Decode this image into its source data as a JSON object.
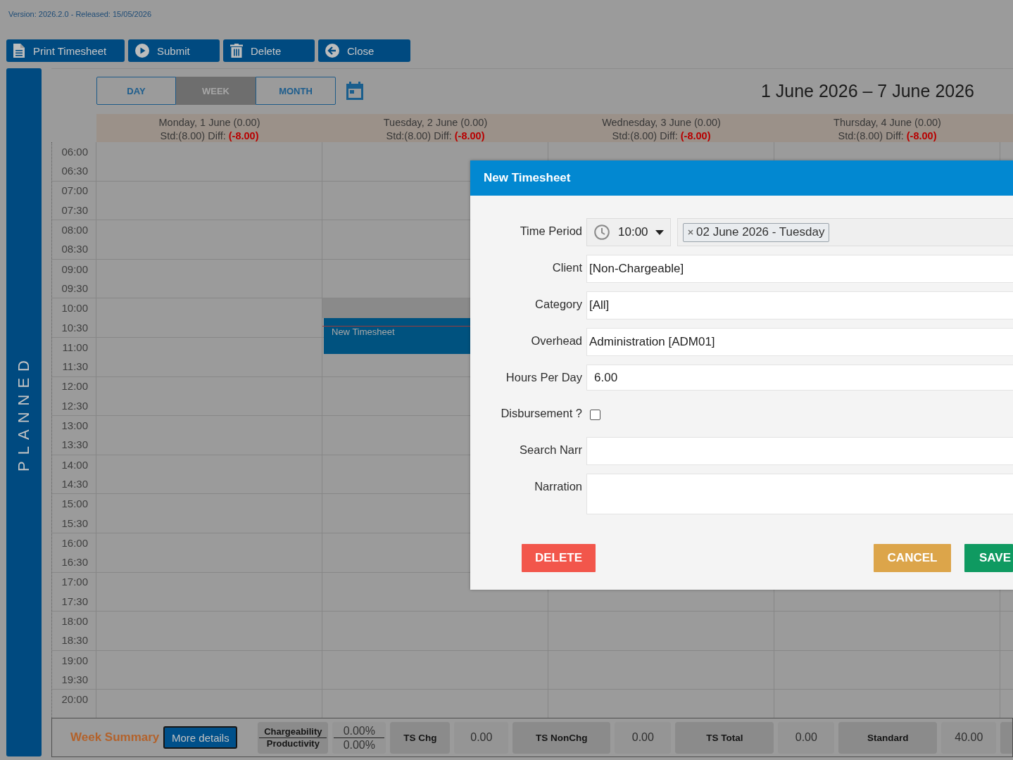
{
  "version_text": "Version: 2026.2.0 - Released: 15/05/2026",
  "toolbar": [
    {
      "label": "Print Timesheet",
      "kind": "print"
    },
    {
      "label": "Submit",
      "kind": "submit"
    },
    {
      "label": "Delete",
      "kind": "delete"
    },
    {
      "label": "Close",
      "kind": "close"
    }
  ],
  "sidebar": {
    "label": "PLANNED"
  },
  "view_tabs": [
    {
      "label": "DAY",
      "selected": false
    },
    {
      "label": "WEEK",
      "selected": true
    },
    {
      "label": "MONTH",
      "selected": false
    }
  ],
  "date_range": "1 June 2026 – 7 June 2026",
  "days": [
    {
      "title": "Monday, 1 June (0.00)",
      "std": "Std:(8.00) Diff:",
      "diff": "(-8.00)"
    },
    {
      "title": "Tuesday, 2 June (0.00)",
      "std": "Std:(8.00) Diff:",
      "diff": "(-8.00)",
      "events": [
        {
          "title": "New Timesheet"
        }
      ]
    },
    {
      "title": "Wednesday, 3 June (0.00)",
      "std": "Std:(8.00) Diff:",
      "diff": "(-8.00)"
    },
    {
      "title": "Thursday, 4 June (0.00)",
      "std": "Std:(8.00) Diff:",
      "diff": "(-8.00)"
    }
  ],
  "time_slots": [
    "06:00",
    "06:30",
    "07:00",
    "07:30",
    "08:00",
    "08:30",
    "09:00",
    "09:30",
    "10:00",
    "10:30",
    "11:00",
    "11:30",
    "12:00",
    "12:30",
    "13:00",
    "13:30",
    "14:00",
    "14:30",
    "15:00",
    "15:30",
    "16:00",
    "16:30",
    "17:00",
    "17:30",
    "18:00",
    "18:30",
    "19:00",
    "19:30",
    "20:00"
  ],
  "week_summary": {
    "title": "Week Summary",
    "details_button": "More details",
    "ratio_labels": [
      "Chargeability",
      "Productivity"
    ],
    "ratio_values": [
      "0.00%",
      "0.00%"
    ],
    "stats": [
      {
        "label": "TS Chg",
        "value": "0.00"
      },
      {
        "label": "TS NonChg",
        "value": "0.00"
      },
      {
        "label": "TS Total",
        "value": "0.00"
      },
      {
        "label": "Standard",
        "value": "40.00"
      }
    ]
  },
  "dialog": {
    "title": "New Timesheet",
    "fields": [
      {
        "label": "Time Period",
        "kind": "time_date",
        "time": "10:00",
        "date_tag": "02 June 2026 - Tuesday"
      },
      {
        "label": "Client",
        "kind": "text",
        "value": "[Non-Chargeable]"
      },
      {
        "label": "Category",
        "kind": "text",
        "value": "[All]"
      },
      {
        "label": "Overhead",
        "kind": "text",
        "value": "Administration [ADM01]"
      },
      {
        "label": "Hours Per Day",
        "kind": "number",
        "value": "6.00"
      },
      {
        "label": "Disbursement ?",
        "kind": "checkbox",
        "checked": false
      },
      {
        "label": "Search Narr",
        "kind": "text"
      },
      {
        "label": "Narration",
        "kind": "textarea"
      }
    ],
    "buttons": [
      {
        "label": "DELETE",
        "kind": "danger"
      },
      {
        "label": "CANCEL",
        "kind": "warning"
      },
      {
        "label": "SAVE",
        "kind": "success"
      }
    ]
  }
}
